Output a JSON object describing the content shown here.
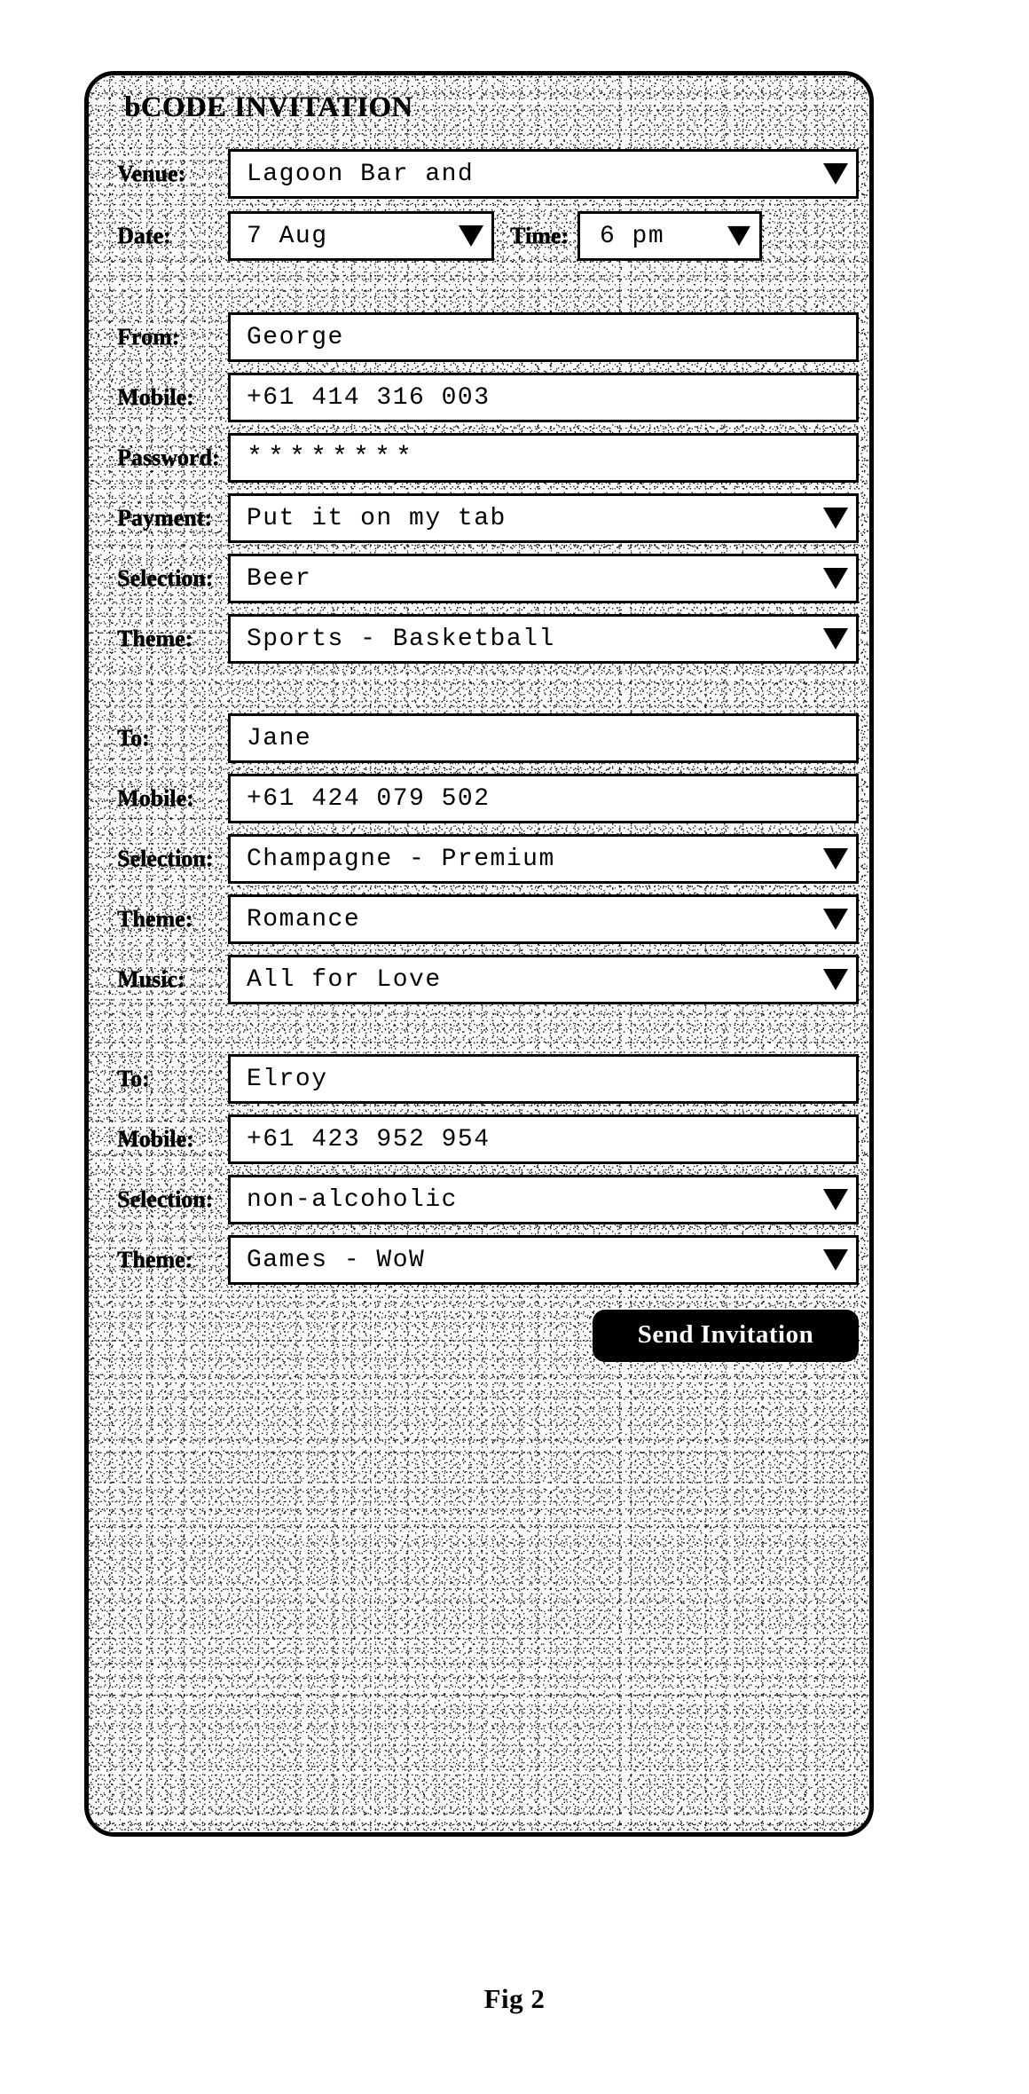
{
  "figure": {
    "caption": "Fig 2"
  },
  "app": {
    "title": "bCODE INVITATION"
  },
  "event": {
    "venue": {
      "label": "Venue:",
      "value": "Lagoon Bar and",
      "caret": "chevron-down-icon"
    },
    "date": {
      "label": "Date:",
      "value": "7 Aug",
      "caret": "chevron-down-icon"
    },
    "time": {
      "label": "Time:",
      "value": "6 pm",
      "caret": "chevron-down-icon"
    }
  },
  "sender": {
    "from": {
      "label": "From:",
      "value": "George"
    },
    "mobile": {
      "label": "Mobile:",
      "value": "+61 414 316 003"
    },
    "password": {
      "label": "Password:",
      "value": "********"
    },
    "payment": {
      "label": "Payment:",
      "value": "Put it on my tab",
      "caret": "chevron-down-icon"
    },
    "selection": {
      "label": "Selection:",
      "value": "Beer",
      "caret": "chevron-down-icon"
    },
    "theme": {
      "label": "Theme:",
      "value": "Sports - Basketball",
      "caret": "chevron-down-icon"
    }
  },
  "recipient1": {
    "to": {
      "label": "To:",
      "value": "Jane"
    },
    "mobile": {
      "label": "Mobile:",
      "value": "+61 424 079 502"
    },
    "selection": {
      "label": "Selection:",
      "value": "Champagne - Premium",
      "caret": "chevron-down-icon"
    },
    "theme": {
      "label": "Theme:",
      "value": "Romance",
      "caret": "chevron-down-icon"
    },
    "music": {
      "label": "Music:",
      "value": "All for Love",
      "caret": "chevron-down-icon"
    }
  },
  "recipient2": {
    "to": {
      "label": "To:",
      "value": "Elroy"
    },
    "mobile": {
      "label": "Mobile:",
      "value": "+61 423 952 954"
    },
    "selection": {
      "label": "Selection:",
      "value": "non-alcoholic",
      "caret": "chevron-down-icon"
    },
    "theme": {
      "label": "Theme:",
      "value": "Games - WoW",
      "caret": "chevron-down-icon"
    }
  },
  "actions": {
    "send": {
      "label": "Send Invitation"
    }
  },
  "colors": {
    "ink": "#000000",
    "paper": "#ffffff",
    "button_bg": "#000000",
    "button_fg": "#ffffff"
  }
}
